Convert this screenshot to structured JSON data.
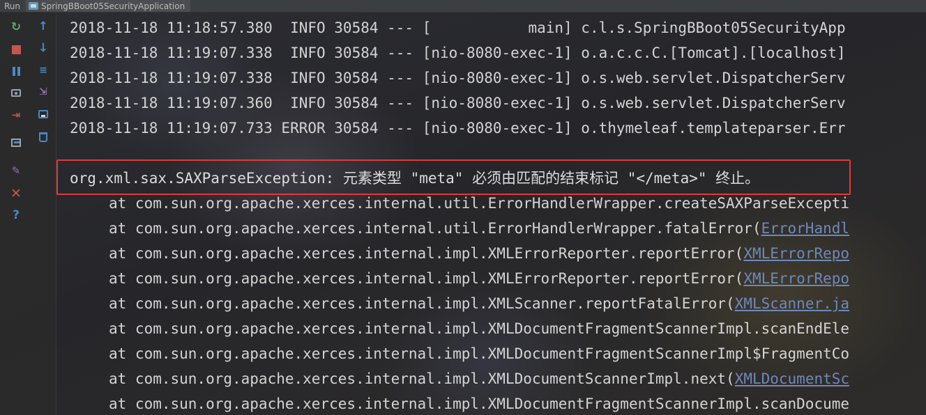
{
  "run_bar": {
    "label": "Run",
    "tab_title": "SpringBBoot05SecurityApplication"
  },
  "toolbar": {
    "left_column": [
      "rerun-icon",
      "stop-icon",
      "pause-icon",
      "camera-icon",
      "login-icon",
      "layout-icon",
      "pin-icon",
      "close-icon",
      "help-icon"
    ],
    "right_column": [
      "scroll-up-icon",
      "scroll-down-icon",
      "soft-wrap-icon",
      "scroll-to-end-icon",
      "print-icon",
      "trash-icon"
    ]
  },
  "console": {
    "log_lines": [
      "2018-11-18 11:18:57.380  INFO 30584 --- [           main] c.l.s.SpringBBoot05SecurityApp",
      "2018-11-18 11:19:07.338  INFO 30584 --- [nio-8080-exec-1] o.a.c.c.C.[Tomcat].[localhost]",
      "2018-11-18 11:19:07.338  INFO 30584 --- [nio-8080-exec-1] o.s.web.servlet.DispatcherServ",
      "2018-11-18 11:19:07.360  INFO 30584 --- [nio-8080-exec-1] o.s.web.servlet.DispatcherServ",
      "2018-11-18 11:19:07.733 ERROR 30584 --- [nio-8080-exec-1] o.thymeleaf.templateparser.Err"
    ],
    "exception_line": "org.xml.sax.SAXParseException: 元素类型 \"meta\" 必须由匹配的结束标记 \"</meta>\" 终止。",
    "stack_trace": [
      {
        "text": "at com.sun.org.apache.xerces.internal.util.ErrorHandlerWrapper.createSAXParseExcepti",
        "location": ""
      },
      {
        "text": "at com.sun.org.apache.xerces.internal.util.ErrorHandlerWrapper.fatalError(",
        "location": "ErrorHandl"
      },
      {
        "text": "at com.sun.org.apache.xerces.internal.impl.XMLErrorReporter.reportError(",
        "location": "XMLErrorRepo"
      },
      {
        "text": "at com.sun.org.apache.xerces.internal.impl.XMLErrorReporter.reportError(",
        "location": "XMLErrorRepo"
      },
      {
        "text": "at com.sun.org.apache.xerces.internal.impl.XMLScanner.reportFatalError(",
        "location": "XMLScanner.ja"
      },
      {
        "text": "at com.sun.org.apache.xerces.internal.impl.XMLDocumentFragmentScannerImpl.scanEndEle",
        "location": ""
      },
      {
        "text": "at com.sun.org.apache.xerces.internal.impl.XMLDocumentFragmentScannerImpl$FragmentCo",
        "location": ""
      },
      {
        "text": "at com.sun.org.apache.xerces.internal.impl.XMLDocumentScannerImpl.next(",
        "location": "XMLDocumentSc"
      },
      {
        "text": "at com.sun.org.apache.xerces.internal.impl.XMLDocumentFragmentScannerImpl.scanDocume",
        "location": ""
      }
    ]
  },
  "colors": {
    "highlight_border": "#e03a3a",
    "link": "#6e89b8",
    "text": "#d4d4d4"
  }
}
